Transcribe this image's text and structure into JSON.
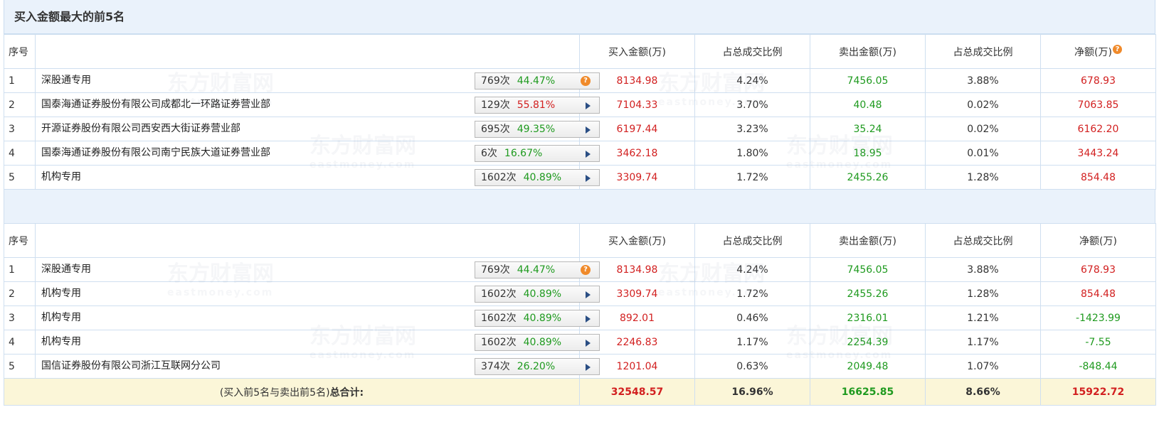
{
  "title": "买入金额最大的前5名",
  "headers": {
    "no": "序号",
    "buy": "买入金额(万)",
    "buy_pct": "占总成交比例",
    "sell": "卖出金额(万)",
    "sell_pct": "占总成交比例",
    "net": "净额(万)",
    "help_icon": "?"
  },
  "buy_table": [
    {
      "no": "1",
      "name": "深股通专用",
      "times": "769次",
      "pct": "44.47%",
      "pct_color": "green",
      "icon": "question-icon",
      "buy": "8134.98",
      "buy_pct": "4.24%",
      "sell": "7456.05",
      "sell_pct": "3.88%",
      "net": "678.93",
      "net_color": "red"
    },
    {
      "no": "2",
      "name": "国泰海通证券股份有限公司成都北一环路证券营业部",
      "times": "129次",
      "pct": "55.81%",
      "pct_color": "red",
      "icon": "arrow-right-icon",
      "buy": "7104.33",
      "buy_pct": "3.70%",
      "sell": "40.48",
      "sell_pct": "0.02%",
      "net": "7063.85",
      "net_color": "red"
    },
    {
      "no": "3",
      "name": "开源证券股份有限公司西安西大街证券营业部",
      "times": "695次",
      "pct": "49.35%",
      "pct_color": "green",
      "icon": "arrow-right-icon",
      "buy": "6197.44",
      "buy_pct": "3.23%",
      "sell": "35.24",
      "sell_pct": "0.02%",
      "net": "6162.20",
      "net_color": "red"
    },
    {
      "no": "4",
      "name": "国泰海通证券股份有限公司南宁民族大道证券营业部",
      "times": "6次",
      "pct": "16.67%",
      "pct_color": "green",
      "icon": "arrow-right-icon",
      "buy": "3462.18",
      "buy_pct": "1.80%",
      "sell": "18.95",
      "sell_pct": "0.01%",
      "net": "3443.24",
      "net_color": "red"
    },
    {
      "no": "5",
      "name": "机构专用",
      "times": "1602次",
      "pct": "40.89%",
      "pct_color": "green",
      "icon": "arrow-right-icon",
      "buy": "3309.74",
      "buy_pct": "1.72%",
      "sell": "2455.26",
      "sell_pct": "1.28%",
      "net": "854.48",
      "net_color": "red"
    }
  ],
  "sell_table": [
    {
      "no": "1",
      "name": "深股通专用",
      "times": "769次",
      "pct": "44.47%",
      "pct_color": "green",
      "icon": "question-icon",
      "buy": "8134.98",
      "buy_pct": "4.24%",
      "sell": "7456.05",
      "sell_pct": "3.88%",
      "net": "678.93",
      "net_color": "red"
    },
    {
      "no": "2",
      "name": "机构专用",
      "times": "1602次",
      "pct": "40.89%",
      "pct_color": "green",
      "icon": "arrow-right-icon",
      "buy": "3309.74",
      "buy_pct": "1.72%",
      "sell": "2455.26",
      "sell_pct": "1.28%",
      "net": "854.48",
      "net_color": "red"
    },
    {
      "no": "3",
      "name": "机构专用",
      "times": "1602次",
      "pct": "40.89%",
      "pct_color": "green",
      "icon": "arrow-right-icon",
      "buy": "892.01",
      "buy_pct": "0.46%",
      "sell": "2316.01",
      "sell_pct": "1.21%",
      "net": "-1423.99",
      "net_color": "green"
    },
    {
      "no": "4",
      "name": "机构专用",
      "times": "1602次",
      "pct": "40.89%",
      "pct_color": "green",
      "icon": "arrow-right-icon",
      "buy": "2246.83",
      "buy_pct": "1.17%",
      "sell": "2254.39",
      "sell_pct": "1.17%",
      "net": "-7.55",
      "net_color": "green"
    },
    {
      "no": "5",
      "name": "国信证券股份有限公司浙江互联网分公司",
      "times": "374次",
      "pct": "26.20%",
      "pct_color": "green",
      "icon": "arrow-right-icon",
      "buy": "1201.04",
      "buy_pct": "0.63%",
      "sell": "2049.48",
      "sell_pct": "1.07%",
      "net": "-848.44",
      "net_color": "green"
    }
  ],
  "total": {
    "label_prefix": "(买入前5名与卖出前5名)",
    "label_bold": "总合计:",
    "buy": "32548.57",
    "buy_pct": "16.96%",
    "sell": "16625.85",
    "sell_pct": "8.66%",
    "net": "15922.72"
  },
  "watermark": {
    "cn": "东方财富网",
    "en": "eastmoney.com"
  },
  "colors": {
    "red": "#d22020",
    "green": "#1f9a1f",
    "header_bg": "#eaf2fb",
    "total_bg": "#fbf6d8",
    "border": "#cfdff0"
  }
}
